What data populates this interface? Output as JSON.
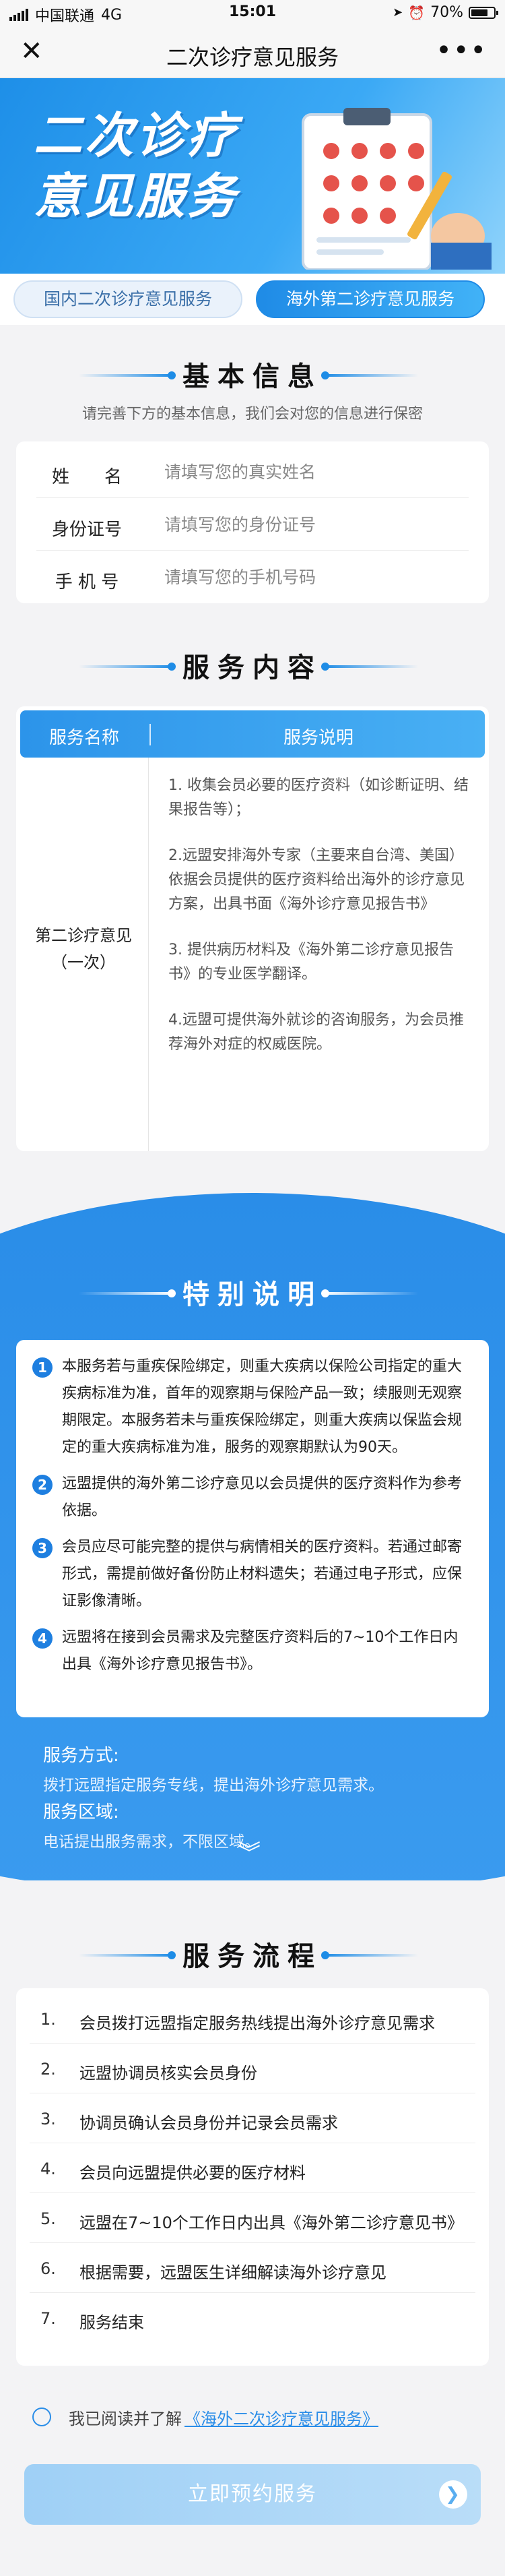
{
  "status_bar": {
    "carrier": "中国联通",
    "network": "4G",
    "time": "15:01",
    "battery": "70%"
  },
  "nav": {
    "title": "二次诊疗意见服务",
    "close_icon": "close-icon",
    "more_icon": "more-icon"
  },
  "banner": {
    "line1": "二次诊疗",
    "line2": "意见服务"
  },
  "tabs": [
    {
      "label": "国内二次诊疗意见服务",
      "active": false
    },
    {
      "label": "海外第二诊疗意见服务",
      "active": true
    }
  ],
  "basic_info": {
    "heading": "基本信息",
    "subtitle": "请完善下方的基本信息，我们会对您的信息进行保密",
    "fields": [
      {
        "label": "姓　　名",
        "placeholder": "请填写您的真实姓名",
        "value": ""
      },
      {
        "label": "身份证号",
        "placeholder": "请填写您的身份证号",
        "value": ""
      },
      {
        "label": "手 机 号",
        "placeholder": "请填写您的手机号码",
        "value": ""
      }
    ]
  },
  "service_content": {
    "heading": "服务内容",
    "col_name": "服务名称",
    "col_desc": "服务说明",
    "name": "第二诊疗意见（一次）",
    "items": [
      "1. 收集会员必要的医疗资料（如诊断证明、结果报告等）；",
      "2.远盟安排海外专家（主要来自台湾、美国）依据会员提供的医疗资料给出海外的诊疗意见方案，出具书面《海外诊疗意见报告书》",
      "3. 提供病历材料及《海外第二诊疗意见报告书》的专业医学翻译。",
      "4.远盟可提供海外就诊的咨询服务，为会员推荐海外对症的权威医院。"
    ]
  },
  "special_notes": {
    "heading": "特别说明",
    "notes": [
      {
        "num": "1",
        "text": "本服务若与重疾保险绑定，则重大疾病以保险公司指定的重大疾病标准为准，首年的观察期与保险产品一致；续服则无观察期限定。本服务若未与重疾保险绑定，则重大疾病以保监会规定的重大疾病标准为准，服务的观察期默认为90天。"
      },
      {
        "num": "2",
        "text": "远盟提供的海外第二诊疗意见以会员提供的医疗资料作为参考依据。"
      },
      {
        "num": "3",
        "text": "会员应尽可能完整的提供与病情相关的医疗资料。若通过邮寄形式，需提前做好备份防止材料遗失；若通过电子形式，应保证影像清晰。"
      },
      {
        "num": "4",
        "text": "远盟将在接到会员需求及完整医疗资料后的7~10个工作日内出具《海外诊疗意见报告书》。"
      }
    ],
    "service_method_label": "服务方式:",
    "service_method": "拨打远盟指定服务专线，提出海外诊疗意见需求。",
    "service_area_label": "服务区域:",
    "service_area": "电话提出服务需求，不限区域。"
  },
  "flow": {
    "heading": "服务流程",
    "steps": [
      {
        "num": "1.",
        "text": "会员拨打远盟指定服务热线提出海外诊疗意见需求"
      },
      {
        "num": "2.",
        "text": "远盟协调员核实会员身份"
      },
      {
        "num": "3.",
        "text": "协调员确认会员身份并记录会员需求"
      },
      {
        "num": "4.",
        "text": "会员向远盟提供必要的医疗材料"
      },
      {
        "num": "5.",
        "text": "远盟在7~10个工作日内出具《海外第二诊疗意见书》"
      },
      {
        "num": "6.",
        "text": "根据需要，远盟医生详细解读海外诊疗意见"
      },
      {
        "num": "7.",
        "text": "服务结束"
      }
    ]
  },
  "agreement": {
    "prefix": "我已阅读并了解",
    "link": "《海外二次诊疗意见服务》"
  },
  "book_button": {
    "label": "立即预约服务"
  },
  "colors": {
    "primary": "#2a8de8",
    "button_disabled": "#a6d3f6"
  }
}
